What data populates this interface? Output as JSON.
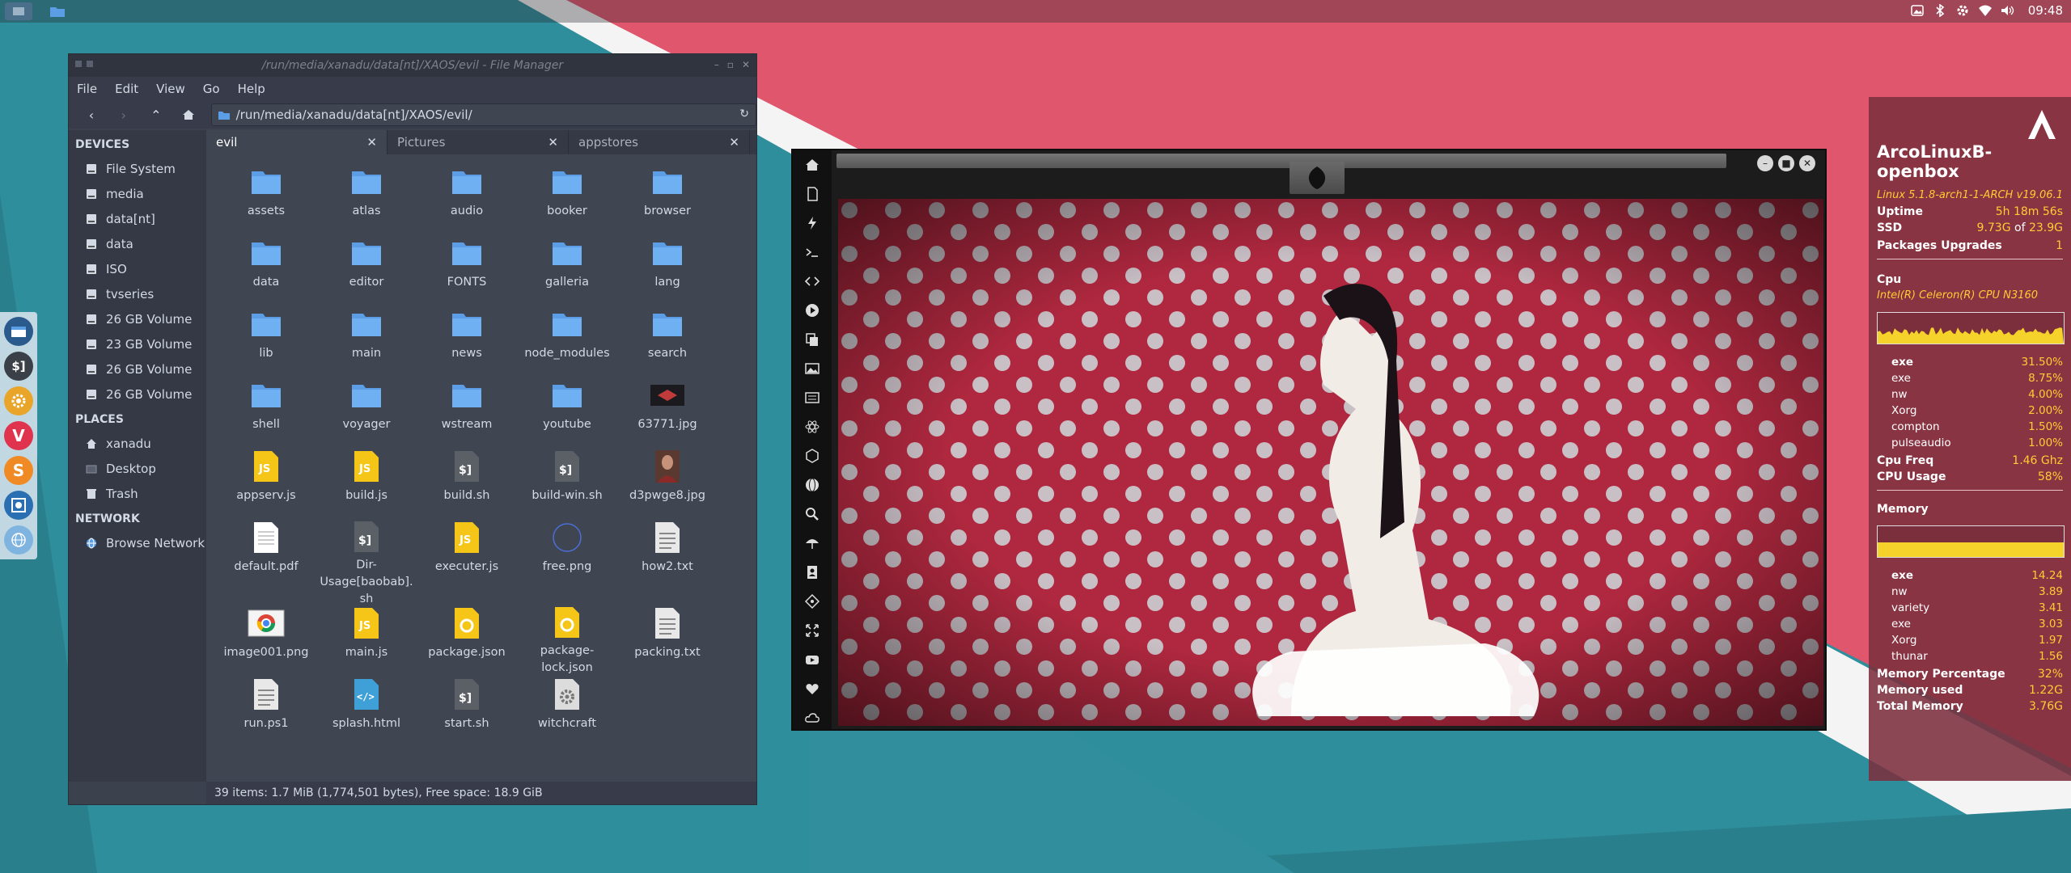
{
  "desktop": {
    "colors": {
      "teal": "#2f8e9c",
      "pink": "#e0566c",
      "white": "#f2f2f2"
    }
  },
  "top_panel": {
    "clock": "09:48",
    "tray_icons": [
      "photo-icon",
      "bluetooth-icon",
      "gear-icon",
      "wifi-icon",
      "volume-icon"
    ]
  },
  "dock": {
    "items": [
      "file-manager-icon",
      "terminal-icon",
      "settings-icon",
      "vivaldi-icon",
      "sublime-icon",
      "screenshot-icon",
      "network-icon"
    ]
  },
  "file_manager": {
    "title": "/run/media/xanadu/data[nt]/XAOS/evil - File Manager",
    "menu": [
      "File",
      "Edit",
      "View",
      "Go",
      "Help"
    ],
    "path": "/run/media/xanadu/data[nt]/XAOS/evil/",
    "sidebar": {
      "devices_header": "DEVICES",
      "devices": [
        "File System",
        "media",
        "data[nt]",
        "data",
        "ISO",
        "tvseries",
        "26 GB Volume",
        "23 GB Volume",
        "26 GB Volume",
        "26 GB Volume"
      ],
      "places_header": "PLACES",
      "places": [
        "xanadu",
        "Desktop",
        "Trash"
      ],
      "network_header": "NETWORK",
      "network": [
        "Browse Network"
      ]
    },
    "tabs": [
      {
        "label": "evil",
        "close": "✕"
      },
      {
        "label": "Pictures",
        "close": "✕"
      },
      {
        "label": "appstores",
        "close": "✕"
      }
    ],
    "files": [
      {
        "name": "assets",
        "kind": "folder"
      },
      {
        "name": "atlas",
        "kind": "folder"
      },
      {
        "name": "audio",
        "kind": "folder"
      },
      {
        "name": "booker",
        "kind": "folder"
      },
      {
        "name": "browser",
        "kind": "folder"
      },
      {
        "name": "data",
        "kind": "folder"
      },
      {
        "name": "editor",
        "kind": "folder"
      },
      {
        "name": "FONTS",
        "kind": "folder"
      },
      {
        "name": "galleria",
        "kind": "folder"
      },
      {
        "name": "lang",
        "kind": "folder"
      },
      {
        "name": "lib",
        "kind": "folder"
      },
      {
        "name": "main",
        "kind": "folder"
      },
      {
        "name": "news",
        "kind": "folder"
      },
      {
        "name": "node_modules",
        "kind": "folder"
      },
      {
        "name": "search",
        "kind": "folder"
      },
      {
        "name": "shell",
        "kind": "folder"
      },
      {
        "name": "voyager",
        "kind": "folder"
      },
      {
        "name": "wstream",
        "kind": "folder"
      },
      {
        "name": "youtube",
        "kind": "folder"
      },
      {
        "name": "63771.jpg",
        "kind": "image-dark"
      },
      {
        "name": "appserv.js",
        "kind": "js"
      },
      {
        "name": "build.js",
        "kind": "js"
      },
      {
        "name": "build.sh",
        "kind": "sh"
      },
      {
        "name": "build-win.sh",
        "kind": "sh"
      },
      {
        "name": "d3pwge8.jpg",
        "kind": "image-photo"
      },
      {
        "name": "default.pdf",
        "kind": "pdf"
      },
      {
        "name": "Dir-Usage[baobab].sh",
        "kind": "sh"
      },
      {
        "name": "executer.js",
        "kind": "js"
      },
      {
        "name": "free.png",
        "kind": "circle"
      },
      {
        "name": "how2.txt",
        "kind": "txt"
      },
      {
        "name": "image001.png",
        "kind": "image-chrome"
      },
      {
        "name": "main.js",
        "kind": "js"
      },
      {
        "name": "package.json",
        "kind": "json"
      },
      {
        "name": "package-lock.json",
        "kind": "json"
      },
      {
        "name": "packing.txt",
        "kind": "txt"
      },
      {
        "name": "run.ps1",
        "kind": "txt"
      },
      {
        "name": "splash.html",
        "kind": "html"
      },
      {
        "name": "start.sh",
        "kind": "sh"
      },
      {
        "name": "witchcraft",
        "kind": "gear"
      }
    ],
    "status": "39 items: 1.7 MiB (1,774,501 bytes), Free space: 18.9 GiB"
  },
  "player": {
    "side_icons": [
      "home-icon",
      "document-icon",
      "lightning-icon",
      "terminal-icon",
      "code-icon",
      "play-icon",
      "copy-icon",
      "image-icon",
      "news-icon",
      "react-icon",
      "hexagon-icon",
      "globe-icon",
      "search-icon",
      "umbrella-icon",
      "contact-icon",
      "git-icon",
      "expand-icon",
      "youtube-icon",
      "heart-icon",
      "cloud-icon"
    ],
    "logo": "rebel-alliance-icon"
  },
  "conky": {
    "title": "ArcoLinuxB-openbox",
    "kernel": "Linux 5.1.8-arch1-1-ARCH",
    "version": "v19.06.1",
    "uptime_label": "Uptime",
    "uptime": "5h 18m 56s",
    "ssd_label": "SSD",
    "ssd_used": "9.73G",
    "ssd_of": "of",
    "ssd_total": "23.9G",
    "pkg_label": "Packages Upgrades",
    "pkg_value": "1",
    "cpu_label": "Cpu",
    "cpu_model": "Intel(R) Celeron(R) CPU  N3160",
    "cpu_procs": [
      {
        "name": "exe",
        "value": "31.50%"
      },
      {
        "name": "exe",
        "value": "8.75%"
      },
      {
        "name": "nw",
        "value": "4.00%"
      },
      {
        "name": "Xorg",
        "value": "2.00%"
      },
      {
        "name": "compton",
        "value": "1.50%"
      },
      {
        "name": "pulseaudio",
        "value": "1.00%"
      }
    ],
    "cpu_freq_label": "Cpu Freq",
    "cpu_freq": "1.46 Ghz",
    "cpu_usage_label": "CPU Usage",
    "cpu_usage": "58%",
    "mem_label": "Memory",
    "mem_procs": [
      {
        "name": "exe",
        "value": "14.24"
      },
      {
        "name": "nw",
        "value": "3.89"
      },
      {
        "name": "variety",
        "value": "3.41"
      },
      {
        "name": "exe",
        "value": "3.03"
      },
      {
        "name": "Xorg",
        "value": "1.97"
      },
      {
        "name": "thunar",
        "value": "1.56"
      }
    ],
    "mem_pct_label": "Memory Percentage",
    "mem_pct": "32%",
    "mem_used_label": "Memory used",
    "mem_used": "1.22G",
    "mem_total_label": "Total Memory",
    "mem_total": "3.76G"
  }
}
